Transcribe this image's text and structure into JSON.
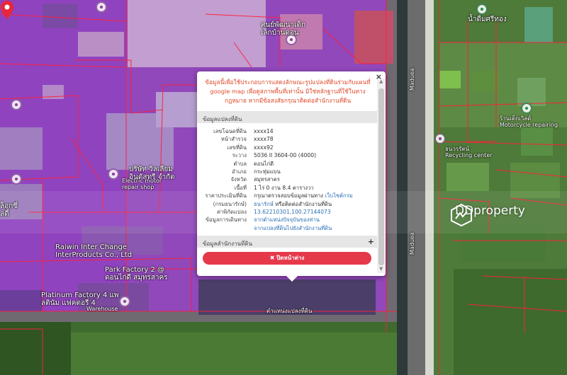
{
  "popup": {
    "notice": "ข้อมูลนี้เพื่อใช้ประกอบการแสดงลักษณะรูปแปลงที่ดินร่วมกับแผนที่ google map เพื่อดูสภาพพื้นที่เท่านั้น มิใช่หลักฐานที่ใช้ในทางกฎหมาย หากมีข้อสงสัยกรุณาติดต่อสำนักงานที่ดิน",
    "close_symbol": "×",
    "section_parcel": "ข้อมูลแปลงที่ดิน",
    "section_office": "ข้อมูลสำนักงานที่ดิน",
    "section_office_toggle": "+",
    "close_button": "✖ ปิดหน้าต่าง",
    "fields": {
      "parcel_no_label": "เลขโฉนดที่ดิน",
      "parcel_no": "xxxx14",
      "survey_page_label": "หน้าสำรวจ",
      "survey_page": "xxxx78",
      "land_no_label": "เลขที่ดิน",
      "land_no": "xxxx92",
      "map_sheet_label": "ระวาง",
      "map_sheet": "5036 II 3604-00 (4000)",
      "tambon_label": "ตำบล",
      "tambon": "ดอนไก่ดี",
      "amphoe_label": "อำเภอ",
      "amphoe": "กระทุ่มแบน",
      "province_label": "จังหวัด",
      "province": "สมุทรสาคร",
      "area_label": "เนื้อที่",
      "area": "1 ไร่ 0 งาน 8.4 ตารางวา",
      "appraisal_label": "ราคาประเมินที่ดิน",
      "appraisal_label2": "(กรมธนารักษ์)",
      "appraisal_text": "กรุณาตรวจสอบข้อมูลผ่านทาง ",
      "appraisal_link": "เว็บไซต์กรม",
      "appraisal_link2": "ธนารักษ์",
      "appraisal_text2": " หรือติดต่อสำนักงานที่ดิน",
      "coords_label": "ค่าพิกัดแปลง",
      "coords": "13.62210301,100.27144073",
      "route_label": "ข้อมูลการเดินทาง",
      "route_link": "จากตำแหน่งปัจจุบันของท่าน",
      "route_link2": "จากแปลงที่ดินไปยังสำนักงานที่ดิน"
    }
  },
  "map": {
    "pin_label": "ตำแหน่งแปลงที่ดิน",
    "labels": {
      "poi_top": "ศูนย์พัฒนาเด็ก\nเล็กบ้านดอน",
      "electric_motor": "Electric motor\nrepair shop",
      "factory_th": "บริษัท วิลเลียม\nอินดัสทรี จำกัด",
      "raiwin": "Raiwin Inter Change\nInterProducts Co., Ltd",
      "park_factory": "Park Factory 2 @\nดอนไก่ดี สมุทรสาคร",
      "platinum": "Platinum Factory 4 แพ\nลตินัม แฟคตอรี่ 4",
      "warehouse": "Warehouse",
      "left_th": "ล็อกซี่\nลดี้",
      "road1": "Maduea",
      "road2": "Maduea",
      "right_top": "น้ำดื่มศรีทอง",
      "right_mid": "ร้านเต็กเวิลด์\nMotorcycle repairing",
      "recycle": "ธนวรรัตน์\nRecycling center"
    },
    "watermark": "DDproperty"
  }
}
